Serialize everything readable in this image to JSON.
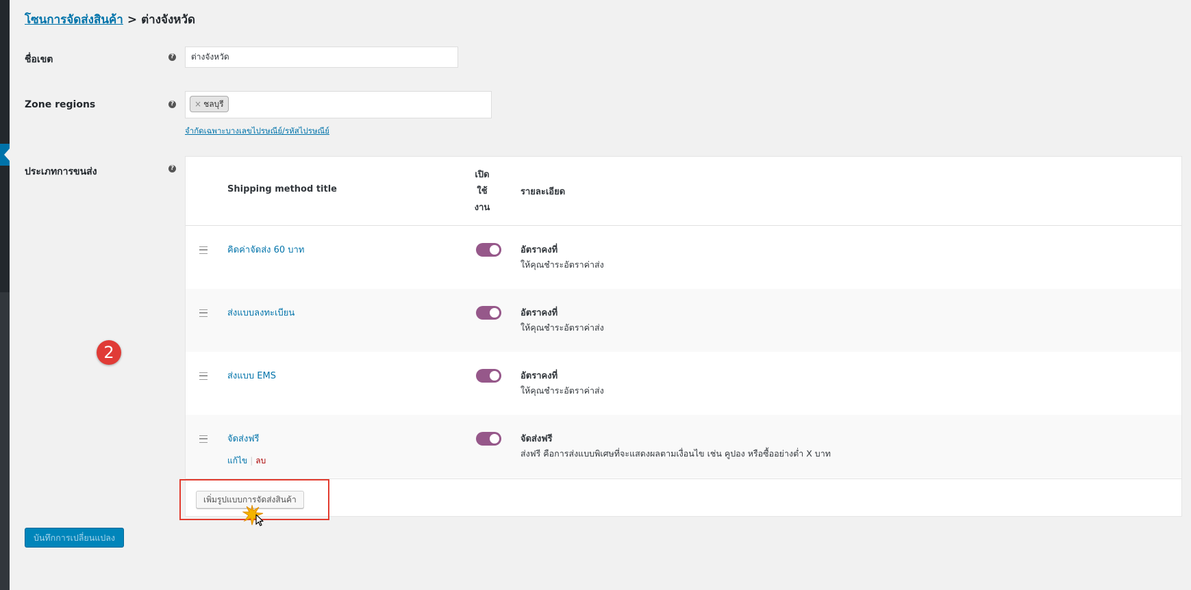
{
  "breadcrumb": {
    "link": "โซนการจัดส่งสินค้า",
    "separator": ">",
    "current": "ต่างจังหวัด"
  },
  "form": {
    "zone_name": {
      "label": "ชื่อเขต",
      "value": "ต่างจังหวัด"
    },
    "zone_regions": {
      "label": "Zone regions",
      "chip_remove": "×",
      "chips": [
        "ชลบุรี"
      ],
      "limit_link": "จำกัดเฉพาะบางเลขไปรษณีย์/รหัสไปรษณีย์"
    },
    "shipping_methods": {
      "label": "ประเภทการขนส่ง"
    },
    "help_glyph": "?"
  },
  "table": {
    "headers": {
      "title": "Shipping method title",
      "enabled": "เปิดใช้งาน",
      "description": "รายละเอียด"
    },
    "rows": [
      {
        "title": "คิดค่าจัดส่ง 60 บาท",
        "enabled": true,
        "desc_title": "อัตราคงที่",
        "desc_text": "ให้คุณชำระอัตราค่าส่ง"
      },
      {
        "title": "ส่งแบบลงทะเบียน",
        "enabled": true,
        "desc_title": "อัตราคงที่",
        "desc_text": "ให้คุณชำระอัตราค่าส่ง"
      },
      {
        "title": "ส่งแบบ EMS",
        "enabled": true,
        "desc_title": "อัตราคงที่",
        "desc_text": "ให้คุณชำระอัตราค่าส่ง"
      },
      {
        "title": "จัดส่งฟรี",
        "enabled": true,
        "desc_title": "จัดส่งฟรี",
        "desc_text": "ส่งฟรี คือการส่งแบบพิเศษที่จะแสดงผลตามเงื่อนไข เช่น คูปอง หรือซื้ออย่างต่ำ X บาท",
        "actions": {
          "edit": "แก้ไข",
          "separator": "|",
          "delete": "ลบ"
        }
      }
    ],
    "add_button": "เพิ่มรูปแบบการจัดส่งสินค้า"
  },
  "annotation": {
    "step_number": "2"
  },
  "save_button": "บันทึกการเปลี่ยนแปลง",
  "colors": {
    "link": "#0073aa",
    "toggle_on": "#96588a",
    "primary_button": "#0085ba",
    "highlight": "#e23b2e",
    "badge": "#e03b36"
  }
}
